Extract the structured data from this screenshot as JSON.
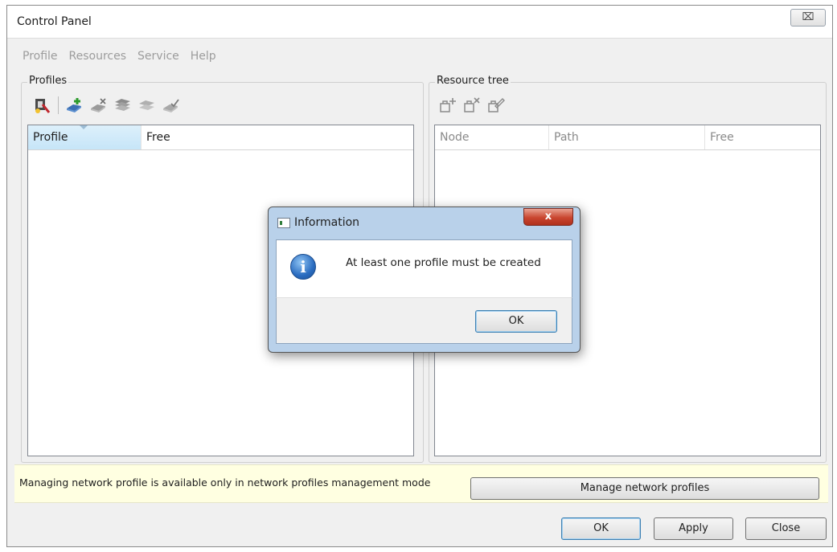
{
  "window": {
    "title": "Control Panel",
    "close_glyph": "⌧"
  },
  "menu": {
    "items": [
      "Profile",
      "Resources",
      "Service",
      "Help"
    ]
  },
  "profiles": {
    "group_label": "Profiles",
    "columns": [
      "Profile",
      "Free"
    ],
    "toolbar_icons": [
      "network-tools-icon",
      "add-profile-icon",
      "delete-profile-icon",
      "profile-stack-icon",
      "profile-disabled-icon",
      "profile-check-icon"
    ]
  },
  "resources": {
    "group_label": "Resource tree",
    "columns": [
      "Node",
      "Path",
      "Free"
    ],
    "toolbar_icons": [
      "add-node-icon",
      "remove-node-icon",
      "edit-node-icon"
    ]
  },
  "infobar": {
    "message": "Managing network profile is available only in network profiles management mode",
    "button_label": "Manage network profiles"
  },
  "buttons": {
    "ok": "OK",
    "apply": "Apply",
    "close": "Close"
  },
  "dialog": {
    "title": "Information",
    "message": "At least one profile must be created",
    "ok_label": "OK",
    "close_glyph": "x",
    "icon_glyph": "i"
  },
  "colors": {
    "accent": "#3c7fb1",
    "info_bar": "#ffffe1",
    "dialog_frame": "#b9d1ea",
    "dialog_close": "#c9452f"
  }
}
